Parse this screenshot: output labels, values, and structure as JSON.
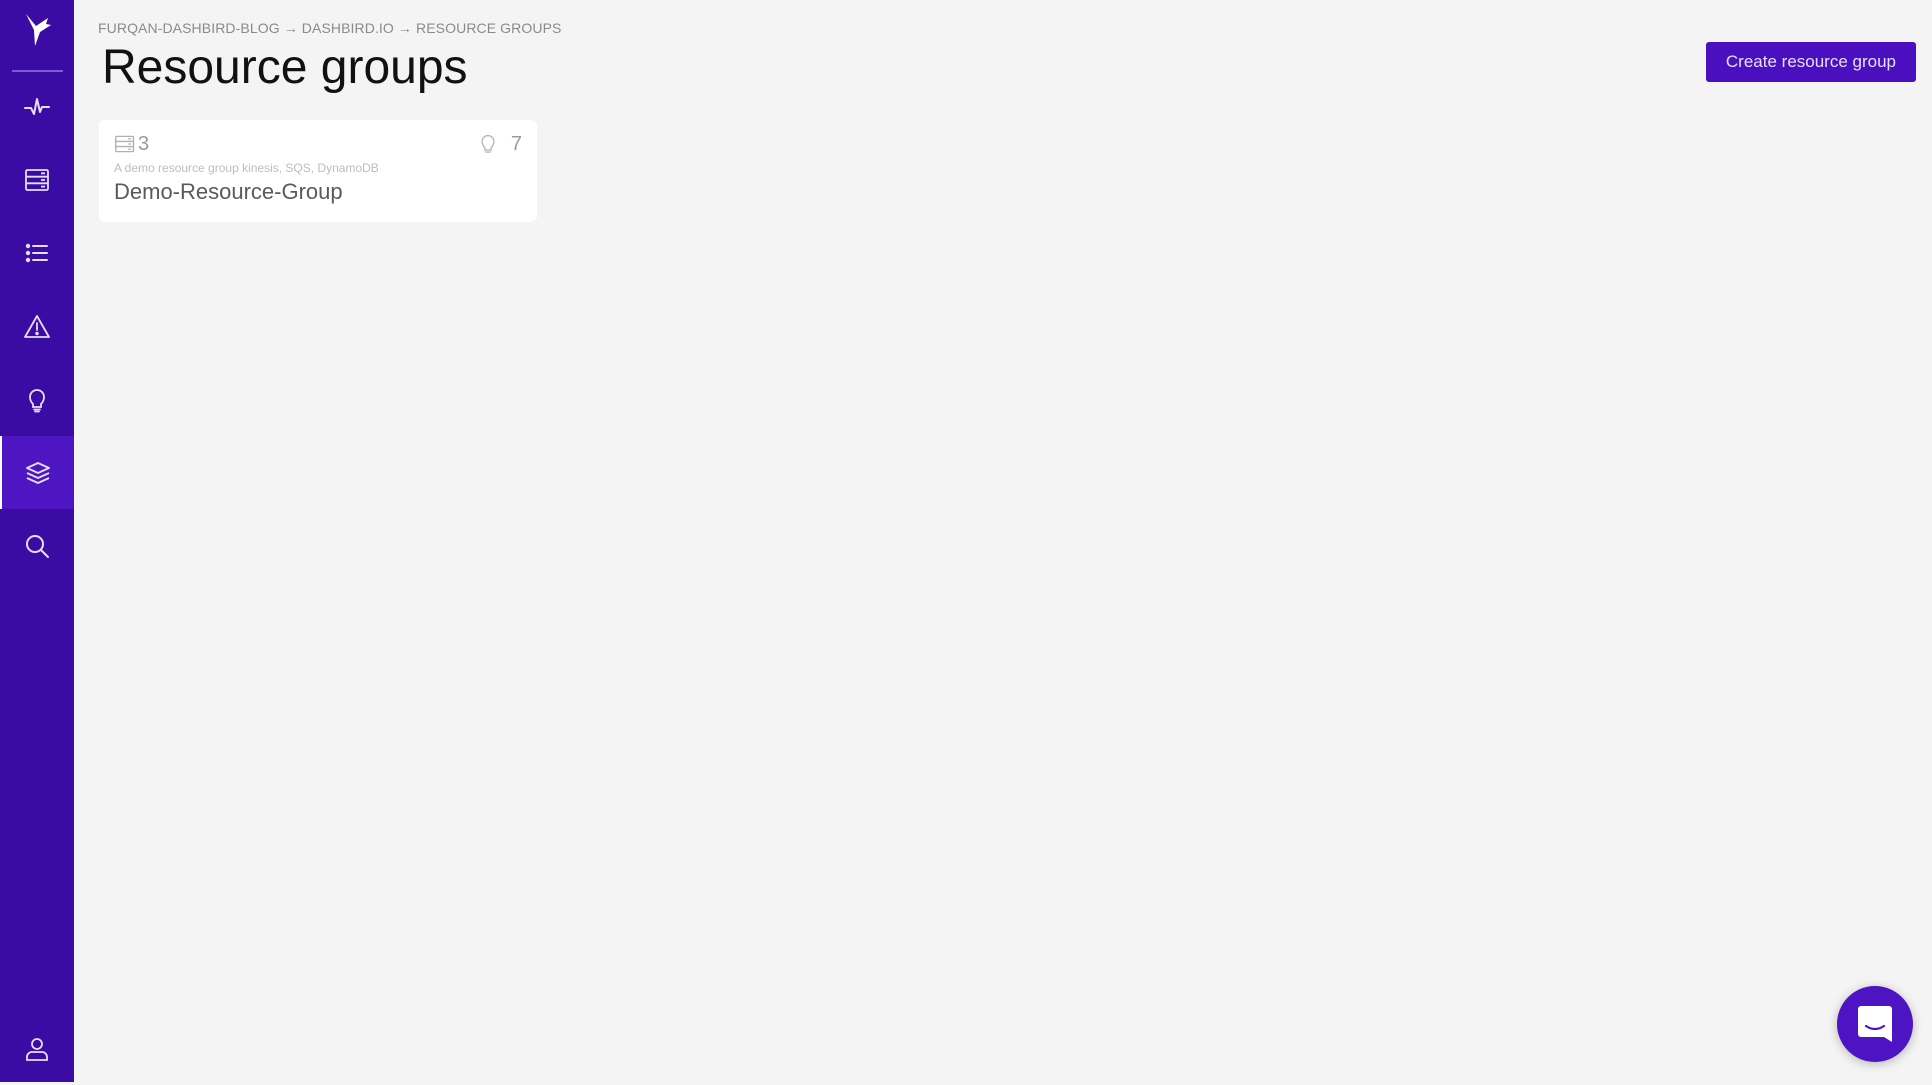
{
  "sidebar": {
    "logo": "dashbird-logo",
    "items": [
      {
        "name": "activity",
        "icon": "pulse-icon",
        "active": false
      },
      {
        "name": "inventory",
        "icon": "server-stack-icon",
        "active": false
      },
      {
        "name": "events",
        "icon": "list-icon",
        "active": false
      },
      {
        "name": "alarms",
        "icon": "warning-icon",
        "active": false
      },
      {
        "name": "insights",
        "icon": "lightbulb-icon",
        "active": false
      },
      {
        "name": "resource-groups",
        "icon": "layers-icon",
        "active": true
      },
      {
        "name": "search",
        "icon": "search-icon",
        "active": false
      }
    ],
    "bottom_item": {
      "name": "account",
      "icon": "user-icon"
    }
  },
  "header": {
    "breadcrumb": [
      "FURQAN-DASHBIRD-BLOG",
      "DASHBIRD.IO",
      "RESOURCE GROUPS"
    ],
    "breadcrumb_separator": "→",
    "title": "Resource groups",
    "create_button_label": "Create resource group"
  },
  "resource_groups": [
    {
      "resources_count": "3",
      "insights_count": "7",
      "description": "A demo resource group kinesis, SQS, DynamoDB",
      "name": "Demo-Resource-Group"
    }
  ],
  "chat_widget": {
    "icon": "chat-icon"
  },
  "colors": {
    "sidebar": "#3a0ca3",
    "sidebar_active": "#4e16c2",
    "accent": "#4a10bf",
    "background": "#f4f4f4"
  }
}
